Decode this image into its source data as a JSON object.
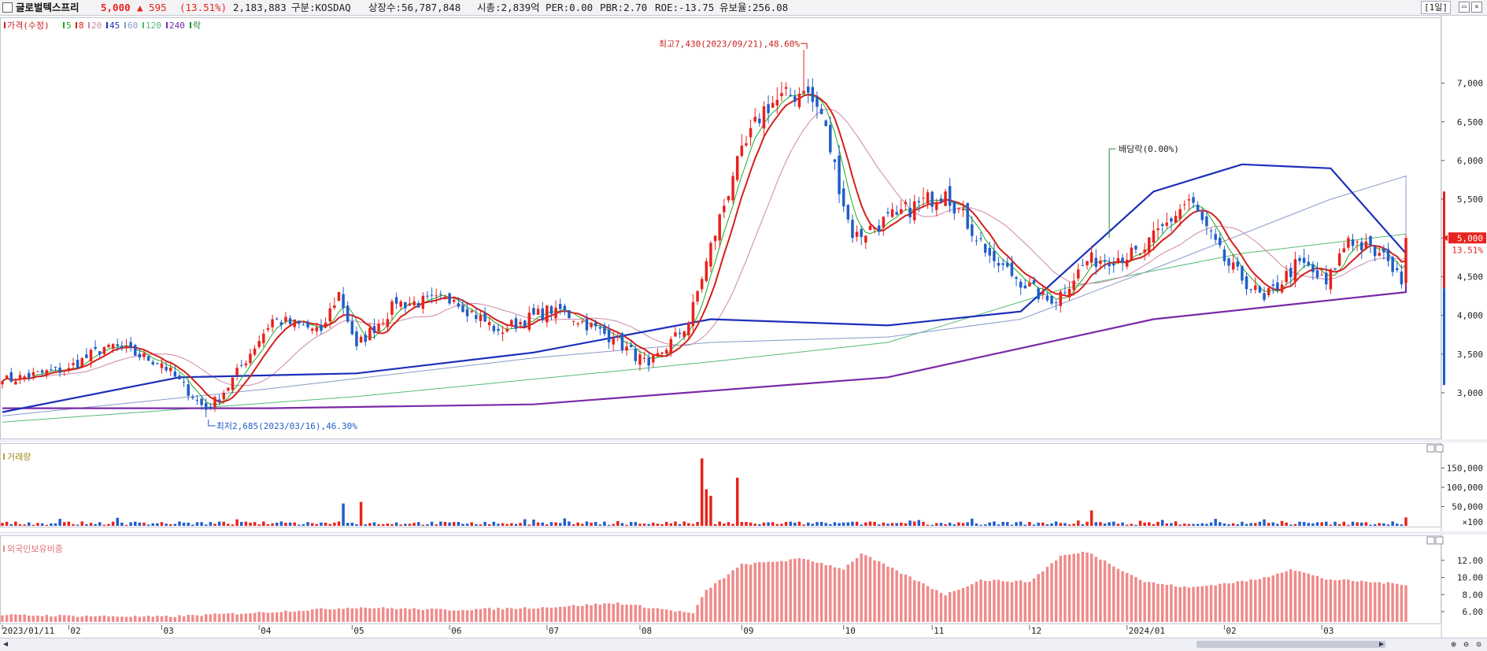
{
  "header": {
    "stock_name": "글로벌텍스프리",
    "price": "5,000",
    "change": "▲ 595",
    "change_pct": "(13.51%)",
    "volume": "2,183,883",
    "market": "구분:KOSDAQ",
    "shares": "상장수:56,787,848",
    "market_cap": "시총:2,839억",
    "per": "PER:0.00",
    "pbr": "PBR:2.70",
    "roe": "ROE:-13.75",
    "float_rate": "유보율:256.08",
    "period": "[1일]",
    "up_color": "#e8221c",
    "down_color": "#1f5ec9"
  },
  "legend": [
    {
      "label": "가격(수정)",
      "color": "#c8201e"
    },
    {
      "label": "5",
      "color": "#22aa22"
    },
    {
      "label": "8",
      "color": "#d4201c"
    },
    {
      "label": "20",
      "color": "#cc88aa"
    },
    {
      "label": "45",
      "color": "#1b2fb8"
    },
    {
      "label": "60",
      "color": "#8899cc"
    },
    {
      "label": "120",
      "color": "#55bb77"
    },
    {
      "label": "240",
      "color": "#7a2aa8"
    },
    {
      "label": "락",
      "color": "#228833"
    }
  ],
  "chart_data": [
    {
      "type": "candlestick",
      "title": "가격(수정)",
      "ylim": [
        2450,
        7850
      ],
      "yticks": [
        3000,
        3500,
        4000,
        4500,
        5000,
        5500,
        6000,
        6500,
        7000
      ],
      "ytick_labels": [
        "3,000",
        "3,500",
        "4,000",
        "4,500",
        "5,000",
        "5,500",
        "6,000",
        "6,500",
        "7,000"
      ],
      "x_labels": [
        "2023/01/11",
        "02",
        "03",
        "04",
        "05",
        "06",
        "07",
        "08",
        "09",
        "10",
        "11",
        "12",
        "2024/01",
        "02",
        "03"
      ],
      "close_anchors": [
        {
          "date": "2023-01-11",
          "close": 3150
        },
        {
          "date": "2023-02-01",
          "close": 3320
        },
        {
          "date": "2023-02-14",
          "close": 3620
        },
        {
          "date": "2023-03-02",
          "close": 3380
        },
        {
          "date": "2023-03-16",
          "close": 2780
        },
        {
          "date": "2023-03-22",
          "close": 3000
        },
        {
          "date": "2023-04-06",
          "close": 3950
        },
        {
          "date": "2023-04-21",
          "close": 3800
        },
        {
          "date": "2023-04-27",
          "close": 4300
        },
        {
          "date": "2023-05-03",
          "close": 3600
        },
        {
          "date": "2023-05-16",
          "close": 4150
        },
        {
          "date": "2023-06-02",
          "close": 4200
        },
        {
          "date": "2023-06-16",
          "close": 3800
        },
        {
          "date": "2023-07-05",
          "close": 4100
        },
        {
          "date": "2023-07-24",
          "close": 3700
        },
        {
          "date": "2023-08-03",
          "close": 3350
        },
        {
          "date": "2023-08-16",
          "close": 3900
        },
        {
          "date": "2023-08-22",
          "close": 4700
        },
        {
          "date": "2023-08-30",
          "close": 5800
        },
        {
          "date": "2023-09-08",
          "close": 6700
        },
        {
          "date": "2023-09-21",
          "close": 6900
        },
        {
          "date": "2023-09-27",
          "close": 6600
        },
        {
          "date": "2023-10-06",
          "close": 5000
        },
        {
          "date": "2023-10-20",
          "close": 5300
        },
        {
          "date": "2023-11-06",
          "close": 5600
        },
        {
          "date": "2023-11-21",
          "close": 4700
        },
        {
          "date": "2023-12-08",
          "close": 4150
        },
        {
          "date": "2023-12-20",
          "close": 4700
        },
        {
          "date": "2024-01-05",
          "close": 4800
        },
        {
          "date": "2024-01-22",
          "close": 5500
        },
        {
          "date": "2024-02-01",
          "close": 4700
        },
        {
          "date": "2024-02-14",
          "close": 4200
        },
        {
          "date": "2024-02-26",
          "close": 4700
        },
        {
          "date": "2024-03-05",
          "close": 4400
        },
        {
          "date": "2024-03-12",
          "close": 5000
        },
        {
          "date": "2024-03-25",
          "close": 4700
        },
        {
          "date": "2024-03-28",
          "close": 4400
        },
        {
          "date": "2024-03-29",
          "close": 5000
        }
      ],
      "series": [
        {
          "name": "45",
          "values": [
            [
              0,
              2750
            ],
            [
              40,
              3200
            ],
            [
              80,
              3250
            ],
            [
              120,
              3520
            ],
            [
              160,
              3950
            ],
            [
              200,
              3870
            ],
            [
              230,
              4050
            ],
            [
              260,
              5600
            ],
            [
              280,
              5950
            ],
            [
              300,
              5900
            ],
            [
              330,
              4800
            ],
            [
              360,
              4750
            ],
            [
              390,
              4650
            ],
            [
              420,
              4580
            ],
            [
              430,
              4620
            ]
          ]
        },
        {
          "name": "60",
          "values": [
            [
              0,
              2700
            ],
            [
              60,
              3050
            ],
            [
              120,
              3450
            ],
            [
              160,
              3650
            ],
            [
              200,
              3720
            ],
            [
              230,
              3950
            ],
            [
              260,
              4600
            ],
            [
              300,
              5500
            ],
            [
              320,
              5800
            ],
            [
              345,
              5350
            ],
            [
              380,
              5100
            ],
            [
              420,
              4800
            ],
            [
              430,
              4700
            ]
          ]
        },
        {
          "name": "120",
          "values": [
            [
              0,
              2620
            ],
            [
              80,
              2950
            ],
            [
              160,
              3400
            ],
            [
              200,
              3650
            ],
            [
              240,
              4350
            ],
            [
              280,
              4800
            ],
            [
              320,
              5050
            ],
            [
              360,
              5250
            ],
            [
              380,
              5300
            ],
            [
              420,
              5100
            ],
            [
              430,
              5000
            ]
          ]
        },
        {
          "name": "240",
          "values": [
            [
              0,
              2800
            ],
            [
              60,
              2800
            ],
            [
              120,
              2850
            ],
            [
              200,
              3200
            ],
            [
              260,
              3950
            ],
            [
              320,
              4300
            ],
            [
              360,
              4450
            ],
            [
              400,
              4570
            ],
            [
              430,
              4680
            ]
          ]
        }
      ],
      "annotations": [
        {
          "text": "최고7,430(2023/09/21),48.60%",
          "date": "2023-09-21",
          "value": 7430
        },
        {
          "text": "최저2,685(2023/03/16),46.30%",
          "date": "2023-03-16",
          "value": 2685
        },
        {
          "text": "배당락(0.00%)",
          "date": "2023-12-27",
          "value": 5000
        }
      ],
      "last_price_label": "5,000",
      "last_pct_label": "13.51%"
    },
    {
      "type": "bar",
      "title": "거래량",
      "ylim": [
        0,
        190000
      ],
      "yticks": [
        50000,
        100000,
        150000
      ],
      "ytick_labels": [
        "50,000",
        "100,000",
        "150,000"
      ],
      "unit_label": "×100",
      "peaks": [
        {
          "date": "2023-08-21",
          "value": 175000
        },
        {
          "date": "2023-08-22",
          "value": 95000
        },
        {
          "date": "2023-08-23",
          "value": 78000
        },
        {
          "date": "2023-08-31",
          "value": 125000
        },
        {
          "date": "2023-04-28",
          "value": 58000
        },
        {
          "date": "2023-05-04",
          "value": 62000
        },
        {
          "date": "2023-12-21",
          "value": 40000
        },
        {
          "date": "2024-03-29",
          "value": 21839
        }
      ]
    },
    {
      "type": "bar",
      "title": "외국인보유비중",
      "ylim": [
        4.8,
        14.2
      ],
      "yticks": [
        6,
        8,
        10,
        12
      ],
      "ytick_labels": [
        "6.00",
        "8.00",
        "10.00",
        "12.00"
      ],
      "anchors": [
        {
          "date": "2023-01-11",
          "value": 5.6
        },
        {
          "date": "2023-03-02",
          "value": 5.4
        },
        {
          "date": "2023-04-03",
          "value": 5.9
        },
        {
          "date": "2023-05-03",
          "value": 6.5
        },
        {
          "date": "2023-06-01",
          "value": 6.2
        },
        {
          "date": "2023-07-03",
          "value": 6.5
        },
        {
          "date": "2023-07-25",
          "value": 7.0
        },
        {
          "date": "2023-08-17",
          "value": 5.8
        },
        {
          "date": "2023-08-22",
          "value": 8.5
        },
        {
          "date": "2023-09-01",
          "value": 11.5
        },
        {
          "date": "2023-09-21",
          "value": 12.2
        },
        {
          "date": "2023-10-04",
          "value": 11.0
        },
        {
          "date": "2023-10-10",
          "value": 12.8
        },
        {
          "date": "2023-10-27",
          "value": 9.5
        },
        {
          "date": "2023-11-06",
          "value": 8.0
        },
        {
          "date": "2023-11-16",
          "value": 9.7
        },
        {
          "date": "2023-12-01",
          "value": 9.5
        },
        {
          "date": "2023-12-12",
          "value": 12.5
        },
        {
          "date": "2023-12-20",
          "value": 13.0
        },
        {
          "date": "2024-01-08",
          "value": 9.5
        },
        {
          "date": "2024-01-22",
          "value": 8.8
        },
        {
          "date": "2024-02-13",
          "value": 9.8
        },
        {
          "date": "2024-02-22",
          "value": 11.0
        },
        {
          "date": "2024-03-05",
          "value": 9.8
        },
        {
          "date": "2024-03-29",
          "value": 9.2
        }
      ]
    }
  ]
}
